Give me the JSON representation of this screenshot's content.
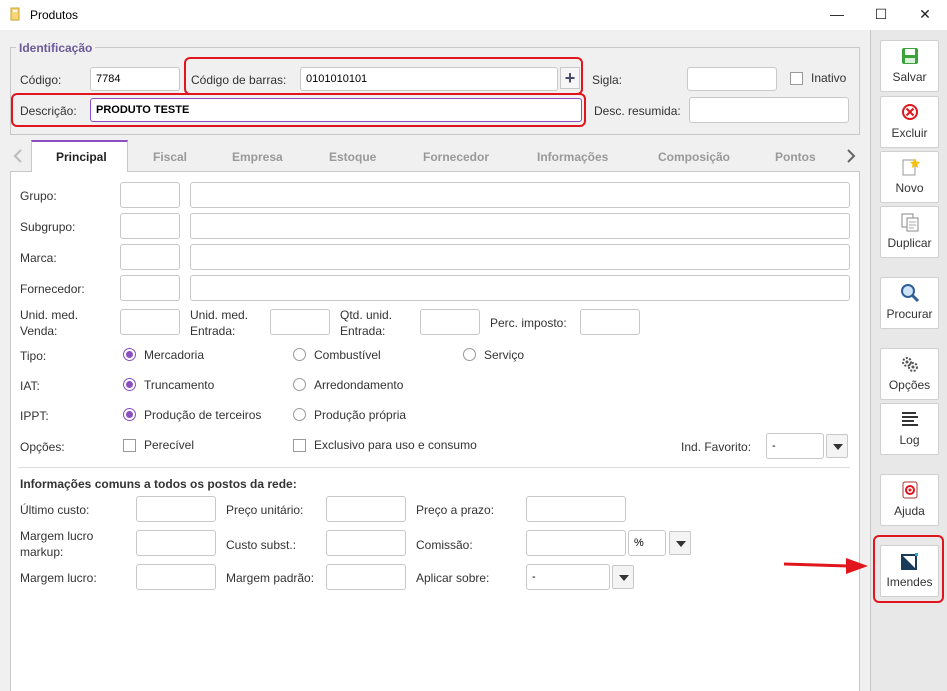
{
  "window": {
    "title": "Produtos",
    "minimize": "—",
    "maximize": "☐",
    "close": "✕"
  },
  "identificacao": {
    "legend": "Identificação",
    "codigo_label": "Código:",
    "codigo_value": "7784",
    "barras_label": "Código de barras:",
    "barras_value": "0101010101",
    "barras_add": "+",
    "sigla_label": "Sigla:",
    "sigla_value": "",
    "inativo_label": "Inativo",
    "descricao_label": "Descrição:",
    "descricao_value": "PRODUTO TESTE",
    "desc_resumida_label": "Desc. resumida:",
    "desc_resumida_value": ""
  },
  "tabs": [
    "Principal",
    "Fiscal",
    "Empresa",
    "Estoque",
    "Fornecedor",
    "Informações",
    "Composição",
    "Pontos"
  ],
  "principal": {
    "grupo": "Grupo:",
    "subgrupo": "Subgrupo:",
    "marca": "Marca:",
    "fornecedor": "Fornecedor:",
    "unid_venda_1": "Unid. med.",
    "unid_venda_2": "Venda:",
    "unid_entrada_1": "Unid. med.",
    "unid_entrada_2": "Entrada:",
    "qtd_entrada_1": "Qtd. unid.",
    "qtd_entrada_2": "Entrada:",
    "perc_imposto": "Perc. imposto:",
    "tipo_label": "Tipo:",
    "tipo_options": [
      "Mercadoria",
      "Combustível",
      "Serviço"
    ],
    "iat_label": "IAT:",
    "iat_options": [
      "Truncamento",
      "Arredondamento"
    ],
    "ippt_label": "IPPT:",
    "ippt_options": [
      "Produção de terceiros",
      "Produção própria"
    ],
    "opcoes_label": "Opções:",
    "opcoes_perecivel": "Perecível",
    "opcoes_exclusivo": "Exclusivo para uso e consumo",
    "ind_favorito_label": "Ind. Favorito:",
    "ind_favorito_value": "-"
  },
  "comuns": {
    "heading": "Informações comuns a todos os postos da rede:",
    "ultimo_custo": "Último custo:",
    "preco_unitario": "Preço unitário:",
    "preco_prazo": "Preço a prazo:",
    "margem_markup_1": "Margem lucro",
    "margem_markup_2": "markup:",
    "custo_subst": "Custo subst.:",
    "comissao": "Comissão:",
    "comissao_unit": "%",
    "margem_lucro": "Margem lucro:",
    "margem_padrao": "Margem padrão:",
    "aplicar_sobre": "Aplicar sobre:",
    "aplicar_value": "-"
  },
  "sidebar": [
    "Salvar",
    "Excluir",
    "Novo",
    "Duplicar",
    "Procurar",
    "Opções",
    "Log",
    "Ajuda",
    "Imendes"
  ],
  "colors": {
    "accent": "#8b4fc2",
    "highlight": "#e0161c",
    "legend": "#6a5a9a"
  }
}
